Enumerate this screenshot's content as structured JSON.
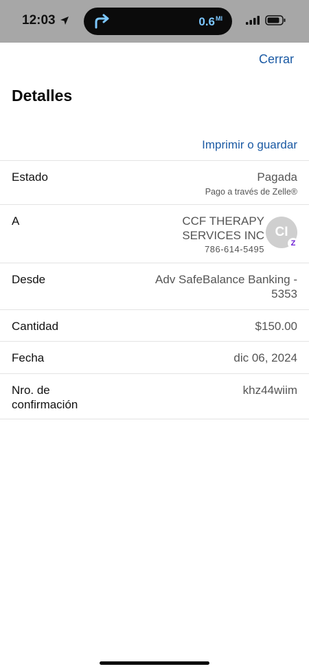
{
  "status_bar": {
    "time": "12:03",
    "nav_distance": "0.6",
    "nav_unit": "MI",
    "icons": [
      "location-arrow-icon",
      "turn-right-icon",
      "signal-icon",
      "battery-icon"
    ]
  },
  "header": {
    "close_label": "Cerrar",
    "title": "Detalles",
    "print_label": "Imprimir o guardar"
  },
  "details": {
    "estado": {
      "label": "Estado",
      "value": "Pagada",
      "sub": "Pago a través de Zelle®"
    },
    "a": {
      "label": "A",
      "name": "CCF THERAPY SERVICES INC",
      "phone": "786-614-5495",
      "avatar_initials": "CI",
      "badge": "Z"
    },
    "desde": {
      "label": "Desde",
      "value": "Adv SafeBalance Banking - 5353"
    },
    "cantidad": {
      "label": "Cantidad",
      "value": "$150.00"
    },
    "fecha": {
      "label": "Fecha",
      "value": "dic 06, 2024"
    },
    "nro": {
      "label": "Nro. de confirmación",
      "value": "khz44wiim"
    }
  },
  "colors": {
    "accent": "#1b5aa4",
    "status_bar_bg": "#a7a7a7",
    "island_text": "#7cc7ff",
    "zelle_purple": "#6d1ed4"
  }
}
